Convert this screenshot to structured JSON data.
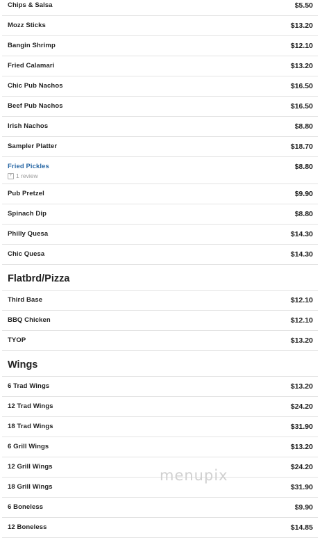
{
  "groups": [
    {
      "heading": "",
      "items": [
        {
          "name": "Chips & Salsa",
          "price": "$5.50"
        },
        {
          "name": "Mozz Sticks",
          "price": "$13.20"
        },
        {
          "name": "Bangin Shrimp",
          "price": "$12.10"
        },
        {
          "name": "Fried Calamari",
          "price": "$13.20"
        },
        {
          "name": "Chic Pub Nachos",
          "price": "$16.50"
        },
        {
          "name": "Beef Pub Nachos",
          "price": "$16.50"
        },
        {
          "name": "Irish Nachos",
          "price": "$8.80"
        },
        {
          "name": "Sampler Platter",
          "price": "$18.70"
        },
        {
          "name": "Fried Pickles",
          "price": "$8.80",
          "link": true,
          "review": "1 review"
        },
        {
          "name": "Pub Pretzel",
          "price": "$9.90"
        },
        {
          "name": "Spinach Dip",
          "price": "$8.80"
        },
        {
          "name": "Philly Quesa",
          "price": "$14.30"
        },
        {
          "name": "Chic Quesa",
          "price": "$14.30"
        }
      ]
    },
    {
      "heading": "Flatbrd/Pizza",
      "items": [
        {
          "name": "Third Base",
          "price": "$12.10"
        },
        {
          "name": "BBQ Chicken",
          "price": "$12.10"
        },
        {
          "name": "TYOP",
          "price": "$13.20"
        }
      ]
    },
    {
      "heading": "Wings",
      "items": [
        {
          "name": "6 Trad Wings",
          "price": "$13.20"
        },
        {
          "name": "12 Trad Wings",
          "price": "$24.20"
        },
        {
          "name": "18 Trad Wings",
          "price": "$31.90"
        },
        {
          "name": "6 Grill Wings",
          "price": "$13.20"
        },
        {
          "name": "12 Grill Wings",
          "price": "$24.20"
        },
        {
          "name": "18 Grill Wings",
          "price": "$31.90"
        },
        {
          "name": "6 Boneless",
          "price": "$9.90"
        },
        {
          "name": "12 Boneless",
          "price": "$14.85"
        }
      ]
    }
  ],
  "watermark": "menupix",
  "review_icon": "plus-square-icon"
}
